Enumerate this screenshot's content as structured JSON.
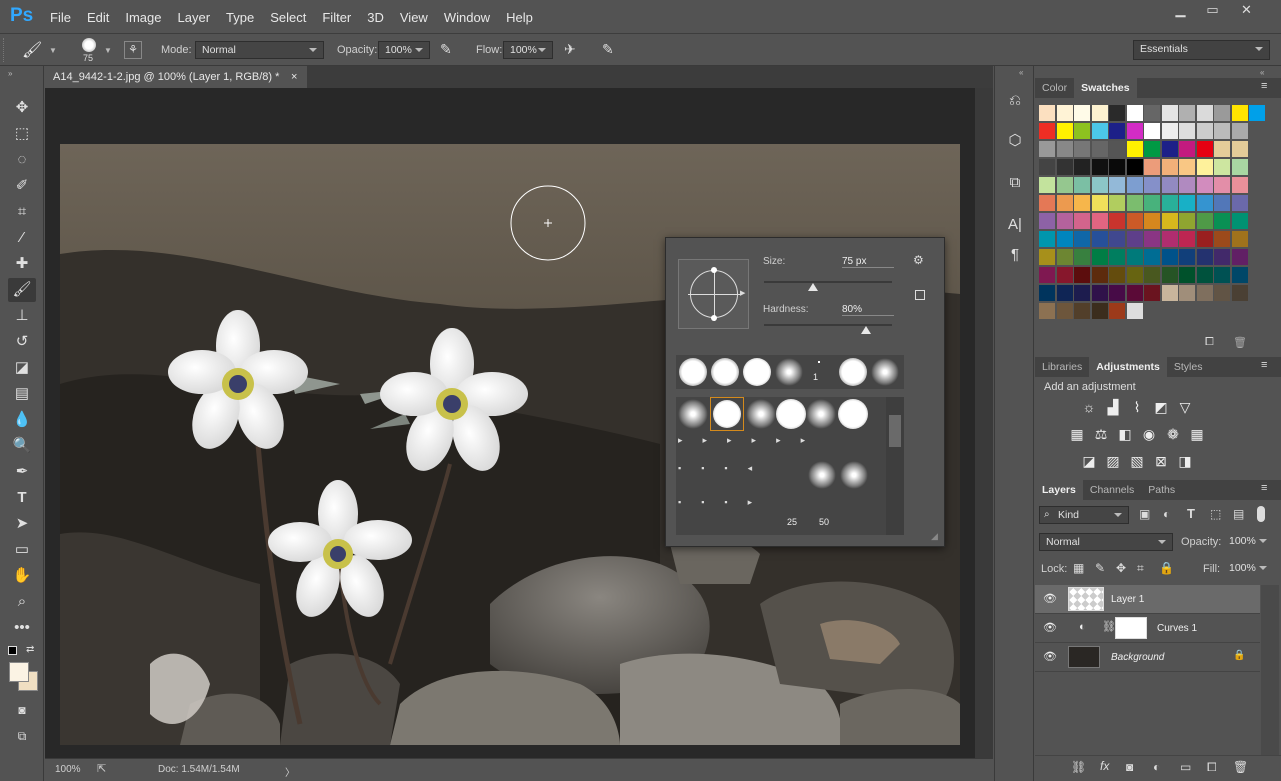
{
  "app": {
    "logo": "Ps"
  },
  "menu": [
    "File",
    "Edit",
    "Image",
    "Layer",
    "Type",
    "Select",
    "Filter",
    "3D",
    "View",
    "Window",
    "Help"
  ],
  "window_controls": {
    "minimize": "minimize-icon",
    "maximize": "maximize-icon",
    "close": "close-icon"
  },
  "options": {
    "brush_size": "75",
    "mode_label": "Mode:",
    "mode_value": "Normal",
    "opacity_label": "Opacity:",
    "opacity_value": "100%",
    "flow_label": "Flow:",
    "flow_value": "100%",
    "workspace": "Essentials"
  },
  "document": {
    "tab_title": "A14_9442-1-2.jpg @ 100% (Layer 1, RGB/8) *",
    "close": "×"
  },
  "status": {
    "zoom": "100%",
    "doc": "Doc: 1.54M/1.54M",
    "arrow": "〉"
  },
  "brush_popup": {
    "size_label": "Size:",
    "size_value": "75 px",
    "hardness_label": "Hardness:",
    "hardness_value": "80%",
    "size_fraction": 0.38,
    "hardness_fraction": 0.8,
    "preset_numbers": [
      "1",
      "25",
      "50"
    ]
  },
  "color_panel": {
    "tabs": [
      "Color",
      "Swatches"
    ],
    "active": "Swatches",
    "swatches": [
      [
        "#fce0c0",
        "#fff3d6",
        "#fffbe8",
        "#fdf2d0",
        "#2a2a2a",
        "#ffffff",
        "#666666",
        "#e4e4e4",
        "#b0b0b0",
        "#dadada",
        "#9a9a9a",
        "#ffe400",
        "#00a0e9"
      ],
      [
        "#ee2e24",
        "#fff100",
        "#8dc21f",
        "#4cc7e8",
        "#1d2088",
        "#d32cc5",
        "#ffffff",
        "#eeeeee",
        "#dddddd",
        "#cccccc",
        "#bbbbbb",
        "#aaaaaa"
      ],
      [
        "#999999",
        "#888888",
        "#777777",
        "#666666",
        "#555555",
        "#fff100",
        "#009944",
        "#1d2088",
        "#c31a7f",
        "#e60012",
        "#e4cc99",
        "#e4cc99"
      ],
      [
        "#444444",
        "#333333",
        "#222222",
        "#111111",
        "#0a0a0a",
        "#000000",
        "#ec9c7a",
        "#f2b079",
        "#f9c784",
        "#fef19b",
        "#cde6a0",
        "#a9d6a2"
      ],
      [
        "#c3e39d",
        "#95c78f",
        "#7bbfa4",
        "#8cc6c7",
        "#93b9d8",
        "#7d9ed0",
        "#8590c9",
        "#928ac1",
        "#b08ac0",
        "#d28cbe",
        "#e38ea8",
        "#ea909a"
      ],
      [
        "#e47856",
        "#ec9a4f",
        "#f6b64b",
        "#f0df5a",
        "#b1cd5f",
        "#7bbd6e",
        "#48b27c",
        "#29b09a",
        "#18b0c6",
        "#3594d0",
        "#5277b8",
        "#6b69ab"
      ],
      [
        "#8d62a6",
        "#b4629d",
        "#d3648c",
        "#e16581",
        "#c9342d",
        "#cc5a27",
        "#d6871e",
        "#d7b81d",
        "#8fa530",
        "#4f9a47",
        "#099054",
        "#009272"
      ],
      [
        "#0096ad",
        "#0085be",
        "#1067a8",
        "#27509a",
        "#40488f",
        "#5e3f8a",
        "#8a3584",
        "#b02d6f",
        "#bd2652",
        "#9a1f1f",
        "#9c4a1b",
        "#a0721c"
      ],
      [
        "#a7901b",
        "#6d8632",
        "#38803f",
        "#007d45",
        "#007e5f",
        "#007a7a",
        "#006d94",
        "#00528a",
        "#113f7a",
        "#24326f",
        "#42296a",
        "#612065"
      ],
      [
        "#7f1851",
        "#87172c",
        "#5c0d0d",
        "#5d2b0d",
        "#644c0d",
        "#676411",
        "#49581f",
        "#265425",
        "#00512b",
        "#00523d",
        "#005153",
        "#004768"
      ],
      [
        "#00345d",
        "#0f2555",
        "#1d1c4e",
        "#30124a",
        "#470b47",
        "#5b0a37",
        "#6a141f",
        "#c8b59c",
        "#a08e7a",
        "#7f6f5e",
        "#615445",
        "#4a4034"
      ],
      [
        "#8c7152",
        "#6d563c",
        "#523f2a",
        "#3b2d1d",
        "#9c3a1a",
        "#dddddd"
      ]
    ]
  },
  "adjustments": {
    "tabs": [
      "Libraries",
      "Adjustments",
      "Styles"
    ],
    "active": "Adjustments",
    "heading": "Add an adjustment"
  },
  "layers": {
    "tabs": [
      "Layers",
      "Channels",
      "Paths"
    ],
    "active": "Layers",
    "filter_kind": "Kind",
    "blend_mode": "Normal",
    "opacity_label": "Opacity:",
    "opacity_value": "100%",
    "lock_label": "Lock:",
    "fill_label": "Fill:",
    "fill_value": "100%",
    "items": [
      {
        "name": "Layer 1"
      },
      {
        "name": "Curves 1"
      },
      {
        "name": "Background"
      }
    ]
  }
}
